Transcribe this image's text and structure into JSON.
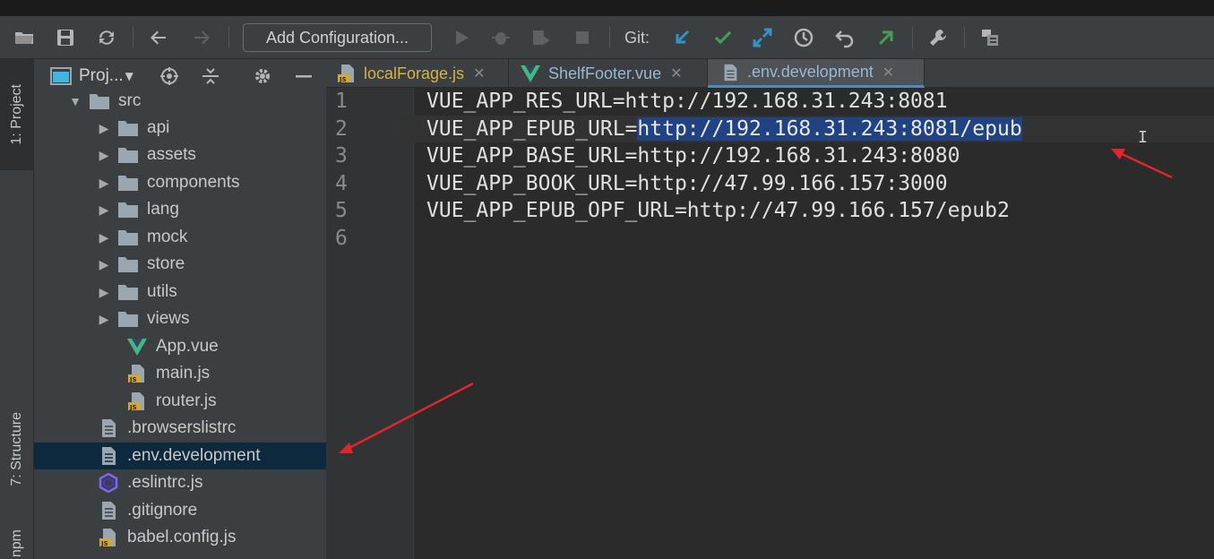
{
  "toolbar": {
    "add_config_label": "Add Configuration...",
    "git_label": "Git:",
    "colors": {
      "blue": "#3592c4",
      "green": "#499c54",
      "accent_arrow": "#499c54"
    }
  },
  "left_stripe": {
    "tabs": [
      {
        "label": "1: Project",
        "icon": "folder-icon"
      },
      {
        "label": "7: Structure",
        "icon": "structure-icon"
      },
      {
        "label": "npm",
        "icon": "npm-icon"
      }
    ]
  },
  "project_panel": {
    "title": "Proj...",
    "tree": [
      {
        "label": "src",
        "type": "folder",
        "expanded": true
      },
      {
        "label": "api",
        "type": "folder"
      },
      {
        "label": "assets",
        "type": "folder"
      },
      {
        "label": "components",
        "type": "folder"
      },
      {
        "label": "lang",
        "type": "folder"
      },
      {
        "label": "mock",
        "type": "folder"
      },
      {
        "label": "store",
        "type": "folder"
      },
      {
        "label": "utils",
        "type": "folder"
      },
      {
        "label": "views",
        "type": "folder"
      },
      {
        "label": "App.vue",
        "type": "vue"
      },
      {
        "label": "main.js",
        "type": "js"
      },
      {
        "label": "router.js",
        "type": "js"
      },
      {
        "label": ".browserslistrc",
        "type": "text"
      },
      {
        "label": ".env.development",
        "type": "text",
        "selected": true
      },
      {
        "label": ".eslintrc.js",
        "type": "eslint"
      },
      {
        "label": ".gitignore",
        "type": "text"
      },
      {
        "label": "babel.config.js",
        "type": "js"
      }
    ]
  },
  "editor_tabs": [
    {
      "label": "localForage.js",
      "icon": "js-file-icon",
      "color": "#d4b24a"
    },
    {
      "label": "ShelfFooter.vue",
      "icon": "vue-icon",
      "color": "#9ab7d3"
    },
    {
      "label": ".env.development",
      "icon": "text-file-icon",
      "color": "#9ab7d3",
      "active": true
    }
  ],
  "editor": {
    "line_numbers": [
      "1",
      "2",
      "3",
      "4",
      "5",
      "6"
    ],
    "lines": [
      {
        "text": "VUE_APP_RES_URL=http://192.168.31.243:8081"
      },
      {
        "prefix": "VUE_APP_EPUB_URL=",
        "selected": "http://192.168.31.243:8081/epub"
      },
      {
        "text": "VUE_APP_BASE_URL=http://192.168.31.243:8080"
      },
      {
        "text": "VUE_APP_BOOK_URL=http://47.99.166.157:3000"
      },
      {
        "text": "VUE_APP_EPUB_OPF_URL=http://47.99.166.157/epub2"
      },
      {
        "text": ""
      }
    ]
  },
  "annotations": {
    "arrow_color": "#e0262a"
  }
}
